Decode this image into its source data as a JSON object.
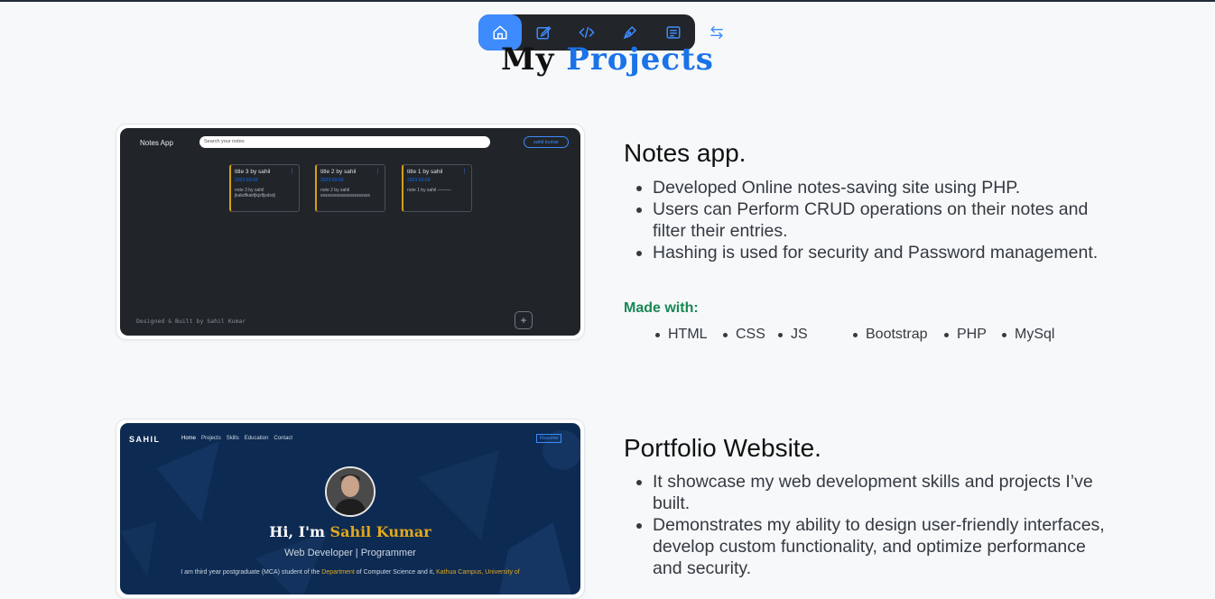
{
  "nav": {
    "items": [
      "home-icon",
      "edit-icon",
      "code-icon",
      "pen-icon",
      "notes-icon"
    ],
    "active": "home-icon",
    "toggle_icon": "swap-arrows-icon"
  },
  "heading": {
    "part1": "My",
    "part2": "Projects"
  },
  "projects": [
    {
      "title": "Notes app.",
      "points": [
        "Developed Online notes-saving site using PHP.",
        "Users can Perform CRUD operations on their notes and filter their entries.",
        "Hashing is used for security and Password management."
      ],
      "made_with_label": "Made with:",
      "tech": [
        "HTML",
        "CSS",
        "JS",
        "Bootstrap",
        "PHP",
        "MySql"
      ],
      "preview": {
        "brand": "Notes App",
        "search_placeholder": "Search your notes",
        "user_button": "sahil kumar",
        "notes": [
          {
            "title": "title 3 by sahil",
            "date": "2023-03-03",
            "body": "note 3 by sahil jkakdfkakfjkjsfljsdsdj"
          },
          {
            "title": "title 2 by sahil",
            "date": "2023-03-03",
            "body": "note 2 by sahil ssssssssssssssssssssss"
          },
          {
            "title": "title 1 by sahil",
            "date": "2023-03-03",
            "body": "note 1 by sahil ———"
          }
        ],
        "footer": "Designed & Built by Sahil Kumar",
        "add_label": "+"
      }
    },
    {
      "title": "Portfolio Website.",
      "points": [
        "It showcase my web development skills and projects I’ve built.",
        "Demonstrates my ability to design user-friendly interfaces, develop custom functionality, and optimize performance and security."
      ],
      "preview": {
        "logo": "SAHIL",
        "nav": [
          "Home",
          "Projects",
          "Skills",
          "Education",
          "Contact"
        ],
        "resume_button": "Resume",
        "greeting": "Hi, I'm",
        "name": "Sahil Kumar",
        "role": "Web Developer | Programmer",
        "about_pre": "I am third year postgraduate (MCA) student of the",
        "about_dept": "Department",
        "about_mid": "of Computer Science and it,",
        "about_campus": "Kathua Campus, University of"
      }
    }
  ]
}
